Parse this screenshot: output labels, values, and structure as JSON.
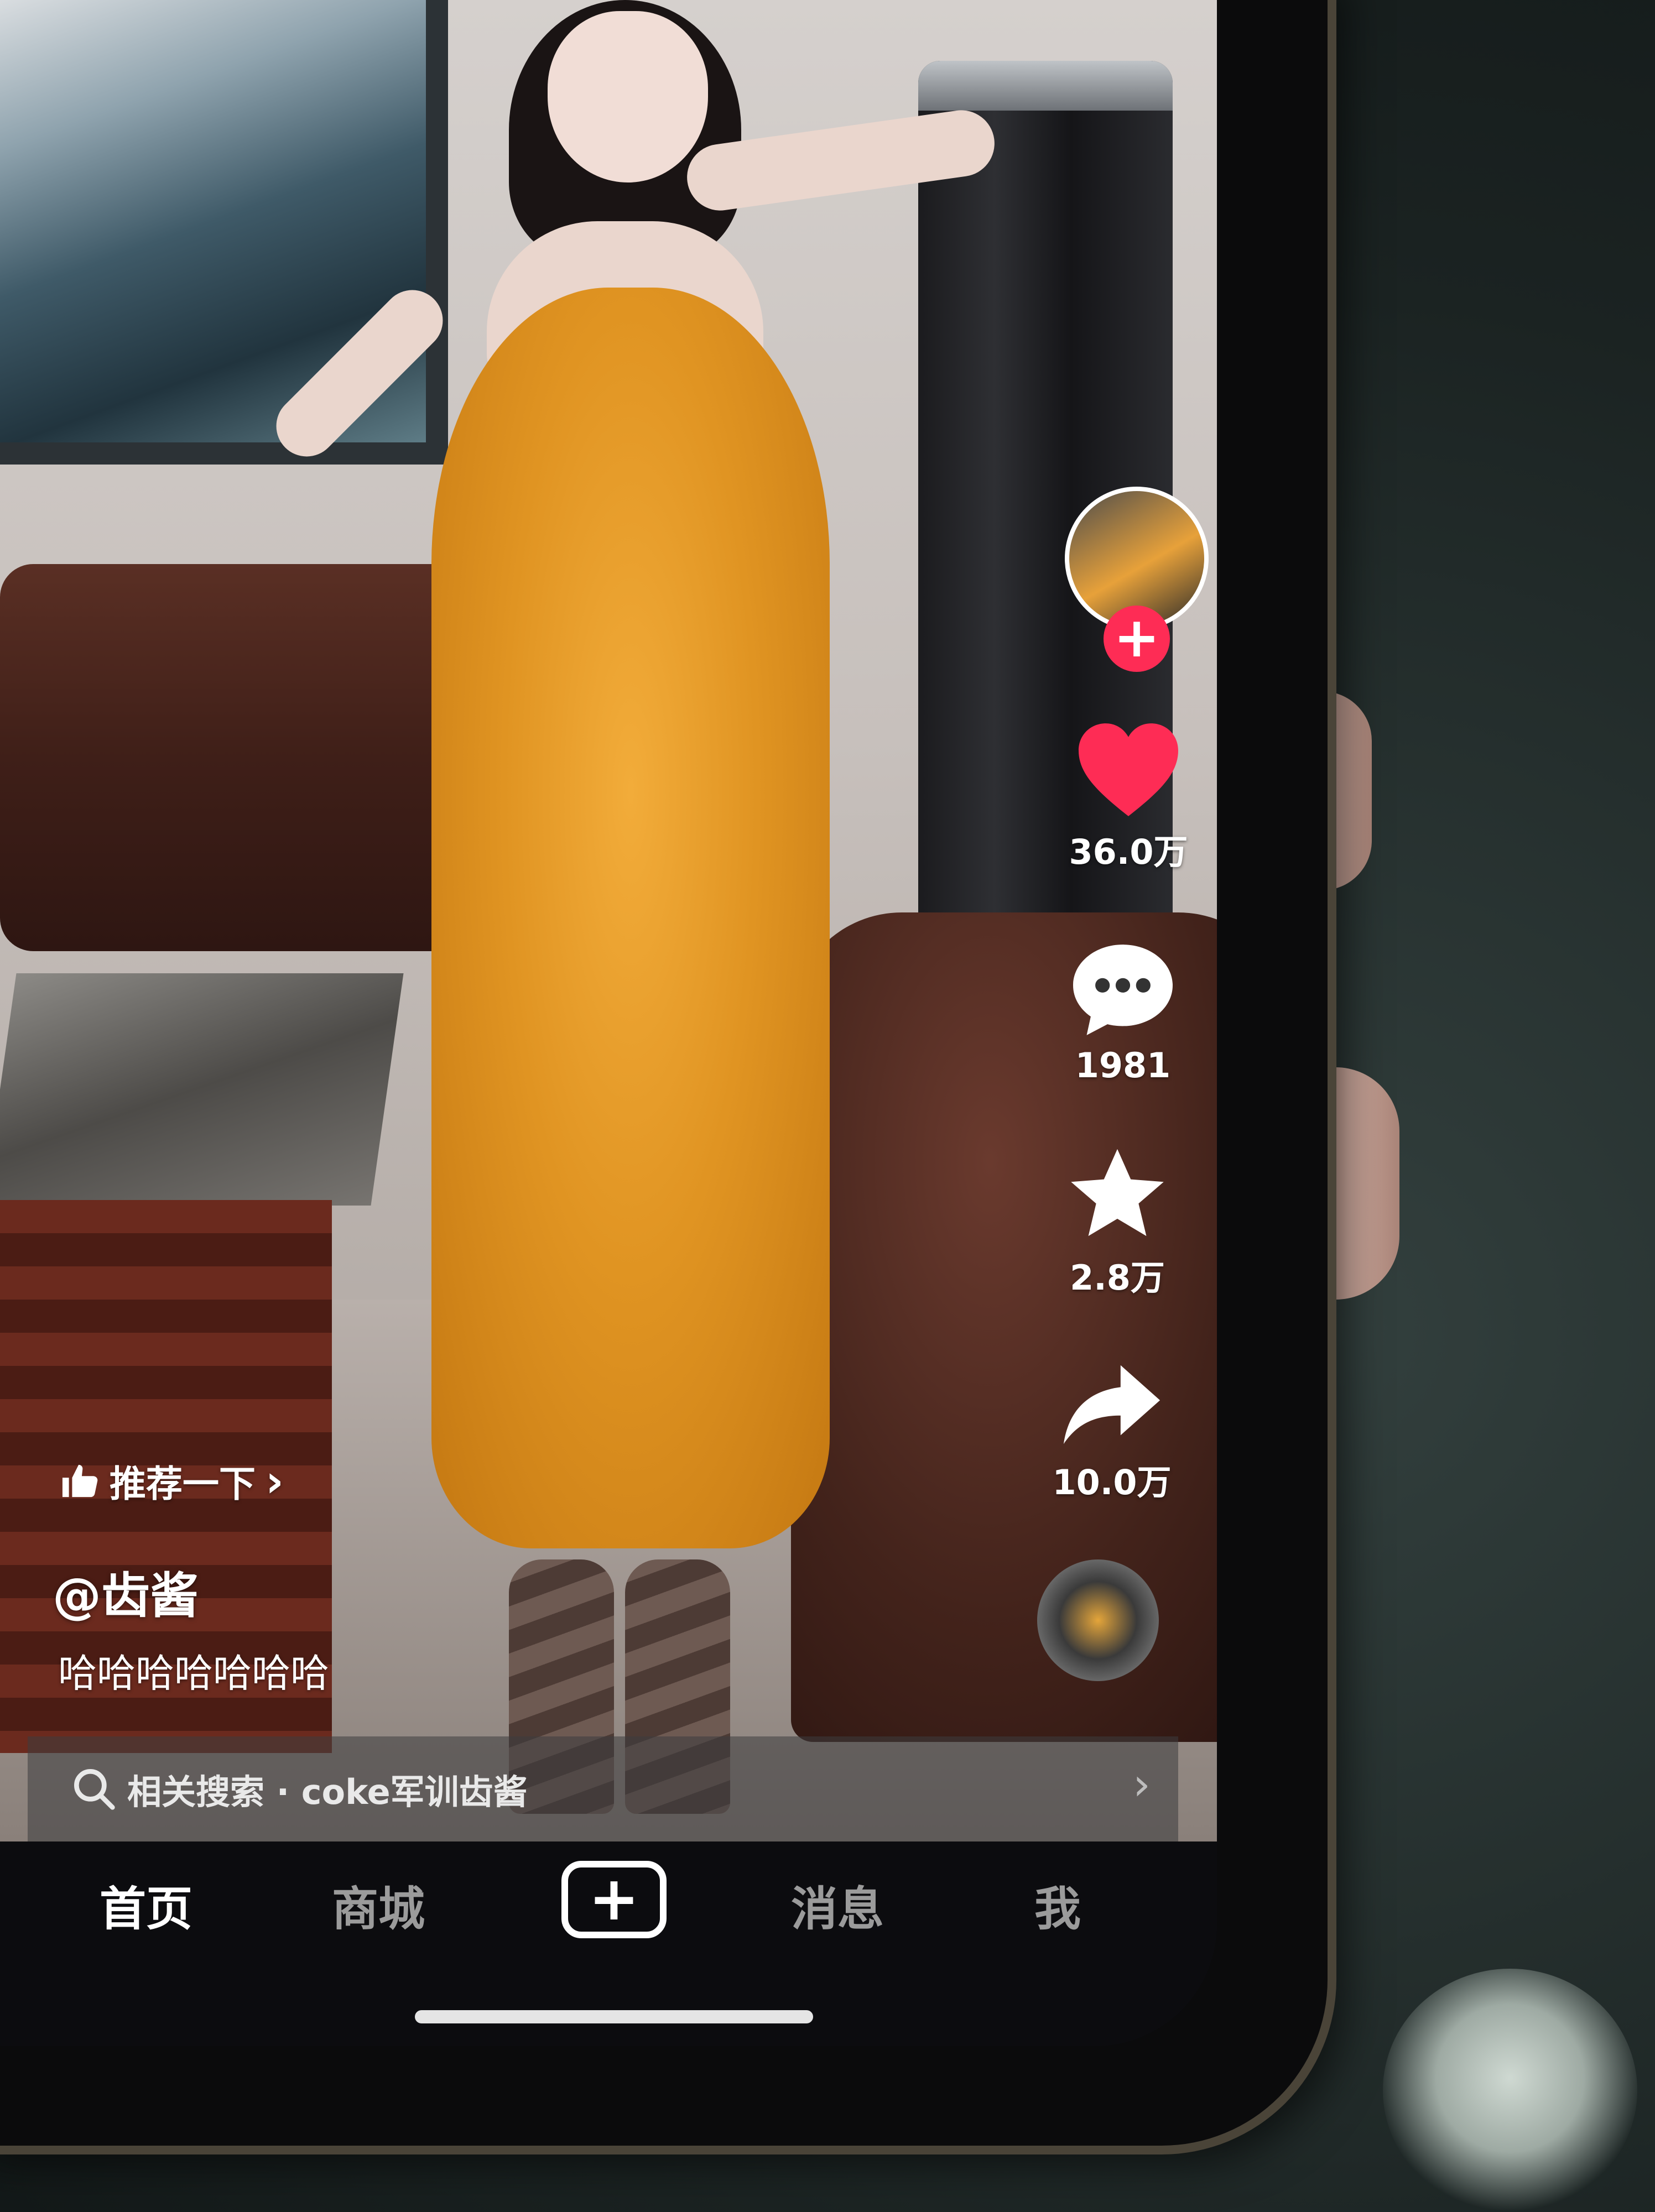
{
  "feed": {
    "author_handle": "@齿酱",
    "caption": "哈哈哈哈哈哈哈",
    "recommend_label": "推荐一下",
    "recommend_chevron": "›"
  },
  "actions": {
    "follow_symbol": "+",
    "likes": "36.0万",
    "comments": "1981",
    "favorites": "2.8万",
    "shares": "10.0万"
  },
  "related_search": {
    "label": "相关搜索 · coke军训齿酱",
    "chevron": "›"
  },
  "tabbar": {
    "home": "首页",
    "mall": "商城",
    "create_symbol": "+",
    "messages": "消息",
    "me": "我"
  },
  "colors": {
    "like_red": "#fe2c55",
    "dress_orange": "#e09422"
  },
  "icons": [
    "thumbs-up-icon",
    "heart-icon",
    "comment-icon",
    "star-icon",
    "share-icon",
    "search-icon",
    "chevron-right-icon",
    "plus-icon"
  ]
}
